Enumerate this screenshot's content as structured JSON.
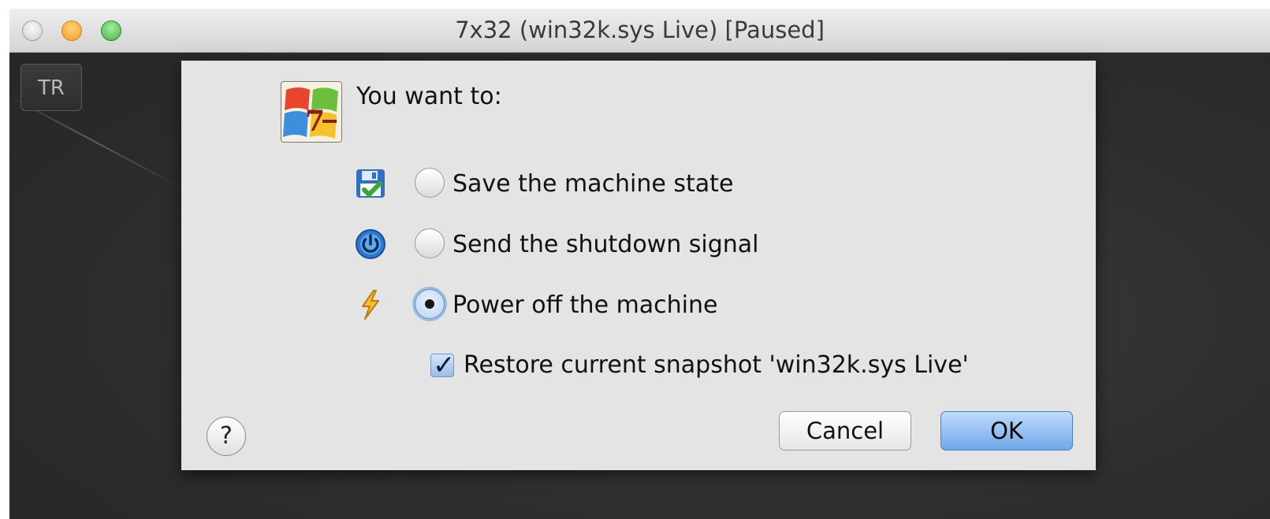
{
  "window": {
    "title": "7x32 (win32k.sys Live) [Paused]",
    "side_button_label": "TR"
  },
  "dialog": {
    "prompt": "You want to:",
    "logo_icon": "windows7-logo-icon",
    "options": [
      {
        "icon": "floppy-disk-save-icon",
        "label": "Save the machine state",
        "selected": false
      },
      {
        "icon": "power-button-icon",
        "label": "Send the shutdown signal",
        "selected": false
      },
      {
        "icon": "lightning-bolt-icon",
        "label": "Power off the machine",
        "selected": true
      }
    ],
    "restore_snapshot": {
      "label": "Restore current snapshot 'win32k.sys Live'",
      "checked": true
    },
    "help_label": "?",
    "cancel_label": "Cancel",
    "ok_label": "OK"
  },
  "colors": {
    "default_button": "#6fa8ea",
    "dialog_background": "#e4e4e4",
    "desktop_background": "#2d2d2d"
  }
}
